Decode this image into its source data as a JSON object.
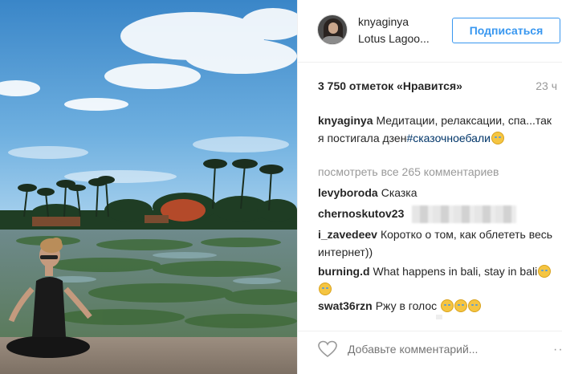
{
  "post": {
    "username": "knyaginya",
    "location": "Lotus Lagoo...",
    "follow_label": "Подписаться",
    "likes": "3 750 отметок «Нравится»",
    "time": "23 ч",
    "caption": {
      "user": "knyaginya",
      "text": "Медитации, релаксации, спа...так я постигала дзен",
      "hashtag": "#сказочноебали"
    },
    "view_all": "посмотреть все 265 комментариев",
    "comments": [
      {
        "user": "levyboroda",
        "text": "Сказка"
      },
      {
        "user": "chernoskutov23",
        "text": ""
      },
      {
        "user": "i_zavedeev",
        "text": "Коротко о том, как облететь весь интернет))"
      },
      {
        "user": "burning.d",
        "text": "What happens in bali, stay in bali"
      },
      {
        "user": "swat36rzn",
        "text": "Ржу в голос"
      }
    ],
    "add_comment_placeholder": "Добавьте комментарий...",
    "more_label": "···"
  },
  "colors": {
    "follow_blue": "#3897f0",
    "hashtag": "#003569",
    "secondary": "#999999"
  },
  "icons": {
    "like": "heart-outline-icon",
    "emoji": "laughing-crying-emoji-icon",
    "more": "more-dots-icon"
  }
}
